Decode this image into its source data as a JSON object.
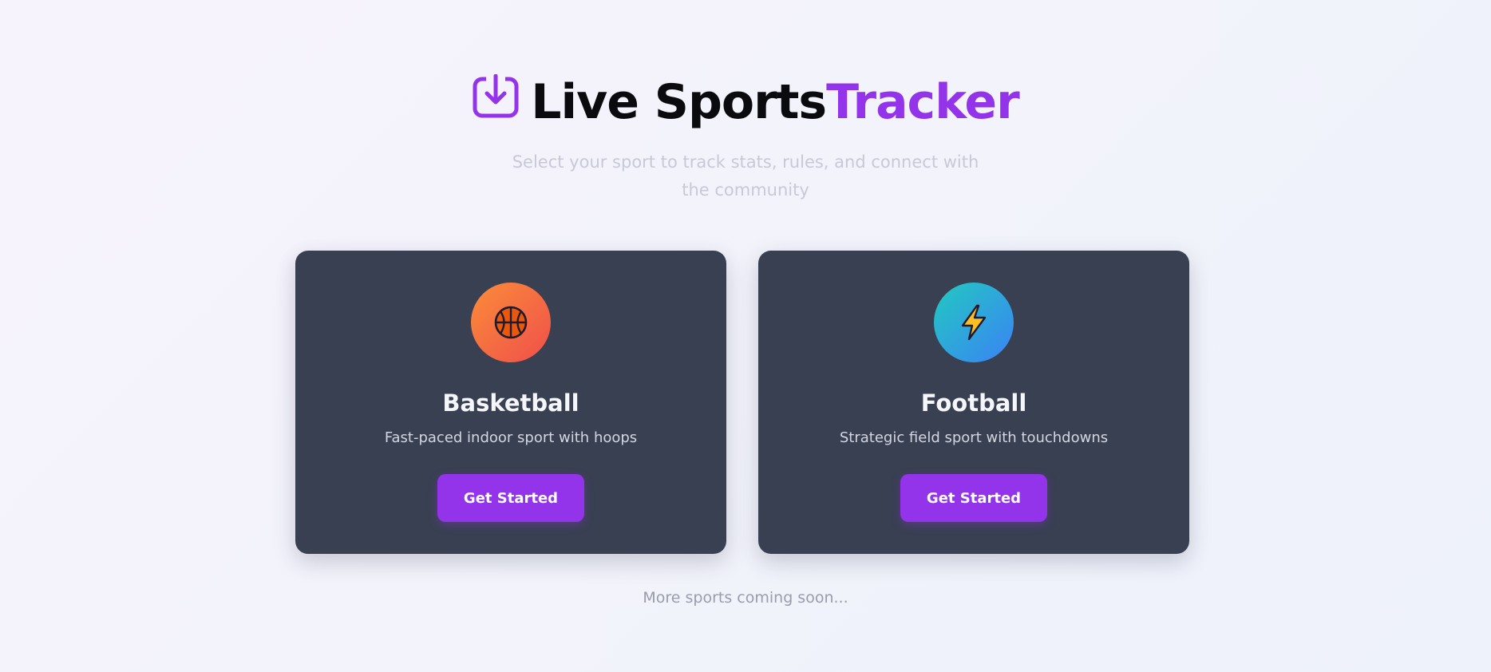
{
  "header": {
    "title_main": "Live Sports",
    "title_accent": "Tracker",
    "subtitle": "Select your sport to track stats, rules, and connect with the community",
    "logo_icon": "download-tray-icon"
  },
  "sports": [
    {
      "name": "Basketball",
      "description": "Fast-paced indoor sport with hoops",
      "button_label": "Get Started",
      "icon": "basketball-icon"
    },
    {
      "name": "Football",
      "description": "Strategic field sport with touchdowns",
      "button_label": "Get Started",
      "icon": "lightning-icon"
    }
  ],
  "footer": {
    "note": "More sports coming soon..."
  },
  "colors": {
    "accent": "#9333ea",
    "card_bg": "#394052",
    "basketball_gradient": [
      "#fb8c3a",
      "#ef4f4a"
    ],
    "football_gradient": [
      "#22c9c0",
      "#3b82f6"
    ]
  }
}
